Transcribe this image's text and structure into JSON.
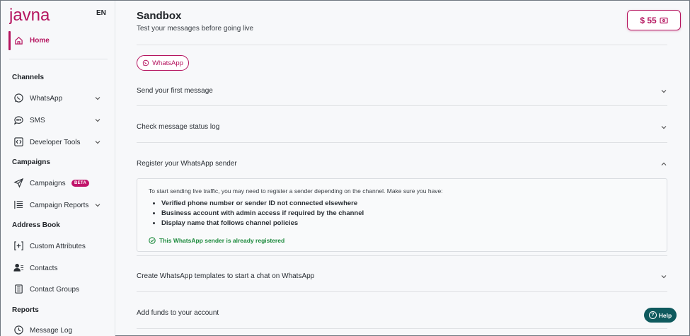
{
  "brand": {
    "logo_text": "javna",
    "color": "#b5145f"
  },
  "sidebar": {
    "language": "EN",
    "home_label": "Home",
    "sections": {
      "channels": "Channels",
      "campaigns": "Campaigns",
      "address_book": "Address Book",
      "reports": "Reports"
    },
    "items": {
      "whatsapp": "WhatsApp",
      "sms": "SMS",
      "developer_tools": "Developer Tools",
      "campaigns": "Campaigns",
      "campaigns_badge": "BETA",
      "campaign_reports": "Campaign Reports",
      "custom_attributes": "Custom Attributes",
      "contacts": "Contacts",
      "contact_groups": "Contact Groups",
      "message_log": "Message Log"
    }
  },
  "header": {
    "title": "Sandbox",
    "subtitle": "Test your messages before going live",
    "balance": "$ 55"
  },
  "channel_chip": "WhatsApp",
  "accordion": [
    {
      "label": "Send your first message",
      "expanded": false
    },
    {
      "label": "Check message status log",
      "expanded": false
    },
    {
      "label": "Register your WhatsApp sender",
      "expanded": true
    },
    {
      "label": "Create WhatsApp templates to start a chat on WhatsApp",
      "expanded": false
    },
    {
      "label": "Add funds to your account",
      "expanded": false
    }
  ],
  "register_panel": {
    "intro": "To start sending live traffic, you may need to register a sender depending on the channel. Make sure you have:",
    "requirements": [
      "Verified phone number or sender ID not connected elsewhere",
      "Business account with admin access if required by the channel",
      "Display name that follows channel policies"
    ],
    "status": "This WhatsApp sender is already registered",
    "status_color": "#1c8a3c"
  },
  "help_label": "Help"
}
